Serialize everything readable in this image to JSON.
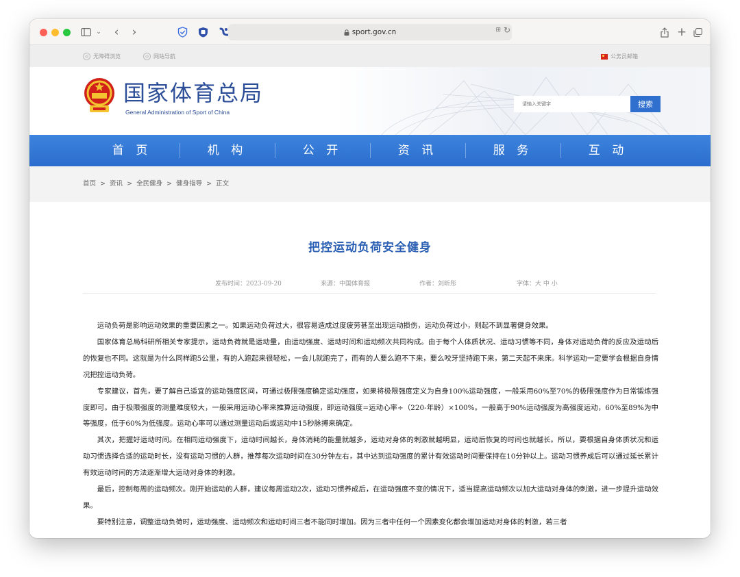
{
  "browser": {
    "url": "sport.gov.cn"
  },
  "util": {
    "accessible": "无障碍浏览",
    "site_nav": "网站导航",
    "mail": "公务员邮箱"
  },
  "header": {
    "title_cn": "国家体育总局",
    "title_en": "General Administration of Sport of China",
    "search_placeholder": "请输入关键字",
    "search_button": "搜索"
  },
  "nav": {
    "items": [
      "首 页",
      "机 构",
      "公 开",
      "资 讯",
      "服 务",
      "互 动"
    ]
  },
  "breadcrumb": {
    "text": "首页  >  资讯  >  全民健身  >  健身指导  >  正文"
  },
  "article": {
    "title": "把控运动负荷安全健身",
    "published": "发布时间：2023-09-20",
    "source": "来源：中国体育报",
    "author": "作者：刘昕彤",
    "font": "字体：大 中 小",
    "paragraphs": [
      "运动负荷是影响运动效果的重要因素之一。如果运动负荷过大，很容易造成过度疲劳甚至出现运动损伤，运动负荷过小，则起不到显著健身效果。",
      "国家体育总局科研所相关专家提示，运动负荷就是运动量，由运动强度、运动时间和运动频次共同构成。由于每个人体质状况、运动习惯等不同，身体对运动负荷的反应及运动后的恢复也不同。这就是为什么同样跑5公里，有的人跑起来很轻松，一会儿就跑完了，而有的人要么跑不下来，要么咬牙坚持跑下来，第二天起不来床。科学运动一定要学会根据自身情况把控运动负荷。",
      "专家建议，首先，要了解自己适宜的运动强度区间，可通过极限强度确定运动强度，如果将极限强度定义为自身100%运动强度，一般采用60%至70%的极限强度作为日常锻炼强度即可。由于极限强度的测量难度较大，一般采用运动心率来推算运动强度，即运动强度=运动心率÷（220-年龄）×100%。一般高于90%运动强度为高强度运动，60%至89%为中等强度，低于60%为低强度。运动心率可以通过测量运动后或运动中15秒脉搏来确定。",
      "其次，把握好运动时间。在相同运动强度下，运动时间越长，身体消耗的能量就越多，运动对身体的刺激就越明显，运动后恢复的时间也就越长。所以，要根据自身体质状况和运动习惯选择合适的运动时长，没有运动习惯的人群，推荐每次运动时间在30分钟左右，其中达到运动强度的累计有效运动时间要保持在10分钟以上。运动习惯养成后可以通过延长累计有效运动时间的方法逐渐增大运动对身体的刺激。",
      "最后，控制每周的运动频次。刚开始运动的人群，建议每周运动2次，运动习惯养成后，在运动强度不变的情况下，适当提高运动频次以加大运动对身体的刺激，进一步提升运动效果。",
      "要特别注意，调整运动负荷时，运动强度、运动频次和运动时间三者不能同时增加。因为三者中任何一个因素变化都会增加运动对身体的刺激，若三者"
    ]
  }
}
